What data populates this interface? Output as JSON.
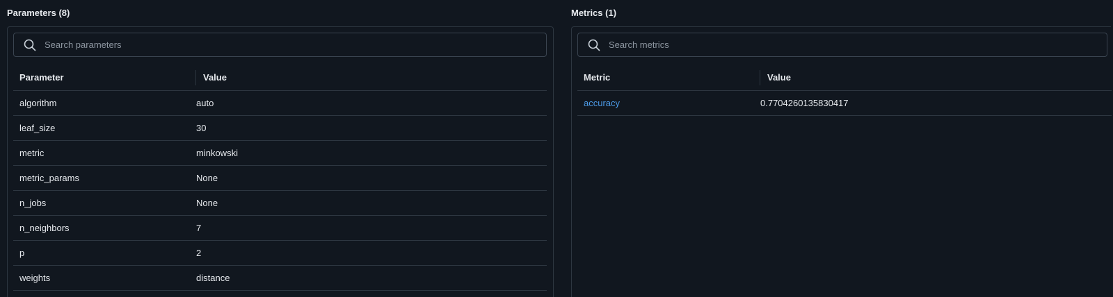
{
  "parameters": {
    "title": "Parameters (8)",
    "search_placeholder": "Search parameters",
    "columns": [
      "Parameter",
      "Value"
    ],
    "rows": [
      {
        "name": "algorithm",
        "value": "auto"
      },
      {
        "name": "leaf_size",
        "value": "30"
      },
      {
        "name": "metric",
        "value": "minkowski"
      },
      {
        "name": "metric_params",
        "value": "None"
      },
      {
        "name": "n_jobs",
        "value": "None"
      },
      {
        "name": "n_neighbors",
        "value": "7"
      },
      {
        "name": "p",
        "value": "2"
      },
      {
        "name": "weights",
        "value": "distance"
      }
    ]
  },
  "metrics": {
    "title": "Metrics (1)",
    "search_placeholder": "Search metrics",
    "columns": [
      "Metric",
      "Value"
    ],
    "rows": [
      {
        "name": "accuracy",
        "value": "0.7704260135830417"
      }
    ]
  },
  "colors": {
    "background": "#11171f",
    "border": "#2d3640",
    "text": "#e6e9ed",
    "link": "#4c9be8",
    "placeholder": "#8d96a0"
  },
  "icons": {
    "search": "search-icon"
  }
}
